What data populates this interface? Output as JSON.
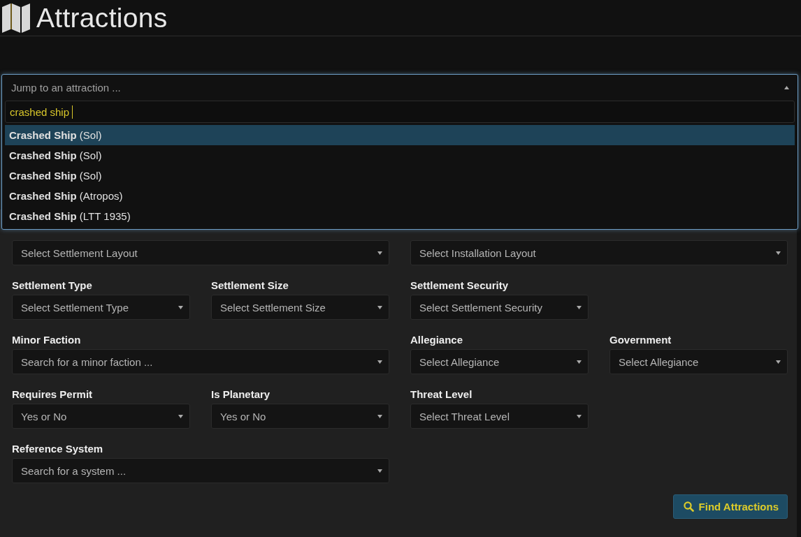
{
  "header": {
    "title": "Attractions"
  },
  "jump": {
    "placeholder": "Jump to an attraction ...",
    "query": "crashed ship",
    "results": [
      {
        "label": "**Crashed Ship** (Sol)",
        "selected": true
      },
      {
        "label": "**Crashed Ship** (Sol)",
        "selected": false
      },
      {
        "label": "**Crashed Ship** (Sol)",
        "selected": false
      },
      {
        "label": "**Crashed Ship** (Atropos)",
        "selected": false
      },
      {
        "label": "**Crashed Ship** (LTT 1935)",
        "selected": false
      }
    ]
  },
  "form_rows": [
    [
      {
        "placeholder": "Select Settlement Layout"
      },
      {
        "placeholder": "Select Installation Layout"
      }
    ],
    [
      {
        "label": "Settlement Type",
        "placeholder": "Select Settlement Type"
      },
      {
        "label": "Settlement Size",
        "placeholder": "Select Settlement Size"
      },
      {
        "label": "Settlement Security",
        "placeholder": "Select Settlement Security"
      }
    ],
    [
      {
        "label": "Minor Faction",
        "placeholder": "Search for a minor faction ..."
      },
      {
        "label": "Allegiance",
        "placeholder": "Select Allegiance"
      },
      {
        "label": "Government",
        "placeholder": "Select Allegiance"
      }
    ],
    [
      {
        "label": "Requires Permit",
        "placeholder": "Yes or No"
      },
      {
        "label": "Is Planetary",
        "placeholder": "Yes or No"
      },
      {
        "label": "Threat Level",
        "placeholder": "Select Threat Level"
      }
    ],
    [
      {
        "label": "Reference System",
        "placeholder": "Search for a system ..."
      }
    ]
  ],
  "submit": {
    "label": "Find Attractions"
  }
}
